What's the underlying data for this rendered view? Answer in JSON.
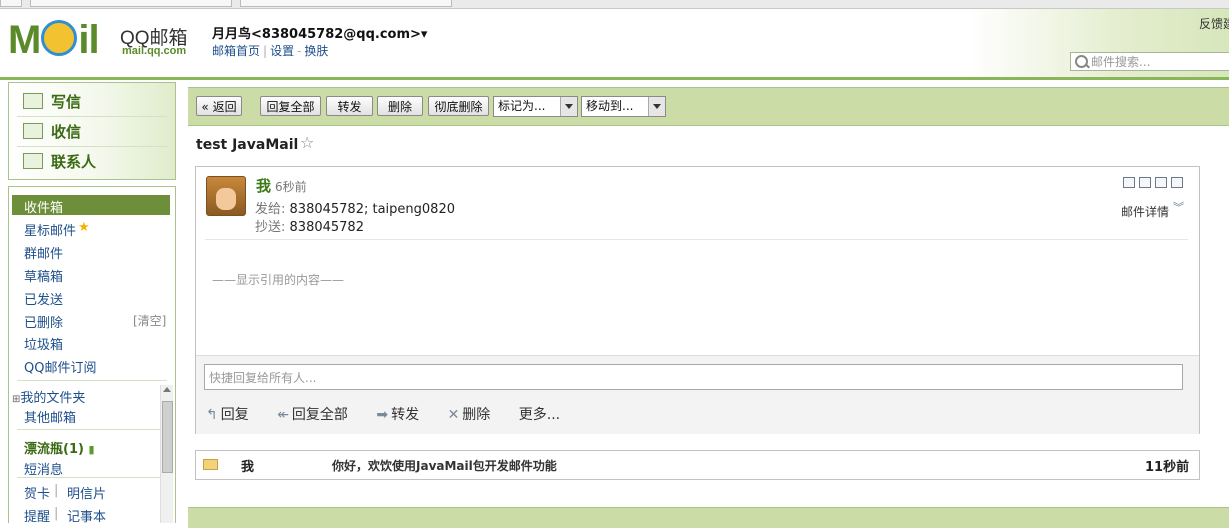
{
  "header": {
    "logo_text": "M il",
    "brand": "QQ邮箱",
    "brand_url": "mail.qq.com",
    "user_display": "月月鸟<838045782@qq.com>▾",
    "links": [
      "邮箱首页",
      "设置",
      "换肤"
    ],
    "feedback": "反馈建",
    "search_placeholder": "邮件搜索..."
  },
  "sidebar": {
    "actions": [
      "写信",
      "收信",
      "联系人"
    ],
    "folders": {
      "inbox": "收件箱",
      "starred": "星标邮件",
      "group": "群邮件",
      "drafts": "草稿箱",
      "sent": "已发送",
      "deleted": "已删除",
      "clear": "[清空]",
      "spam": "垃圾箱",
      "subscription": "QQ邮件订阅",
      "my_folders": "我的文件夹",
      "other_mail": "其他邮箱",
      "drift_bottle": "漂流瓶(1)",
      "sms": "短消息",
      "cards": "贺卡",
      "postcards": "明信片",
      "reminder": "提醒",
      "notebook": "记事本"
    }
  },
  "toolbar": {
    "back": "« 返回",
    "reply_all": "回复全部",
    "forward": "转发",
    "delete": "删除",
    "delete_forever": "彻底删除",
    "mark_as": "标记为...",
    "move_to": "移动到..."
  },
  "mail": {
    "subject": "test JavaMail",
    "sender": "我",
    "time_ago": "6秒前",
    "to_label": "发给:",
    "to": "838045782; taipeng0820",
    "cc_label": "抄送:",
    "cc": "838045782",
    "details": "邮件详情",
    "quoted": "——显示引用的内容——",
    "quick_reply_placeholder": "快捷回复给所有人...",
    "actions": [
      "回复",
      "回复全部",
      "转发",
      "删除",
      "更多..."
    ]
  },
  "thread": {
    "from": "我",
    "subject": "你好，欢饮使用JavaMail包开发邮件功能",
    "time": "11秒前"
  },
  "colors": {
    "accent_green": "#6e8f3a",
    "toolbar_bg": "#cbdca7",
    "link_blue": "#1d4f8b"
  }
}
